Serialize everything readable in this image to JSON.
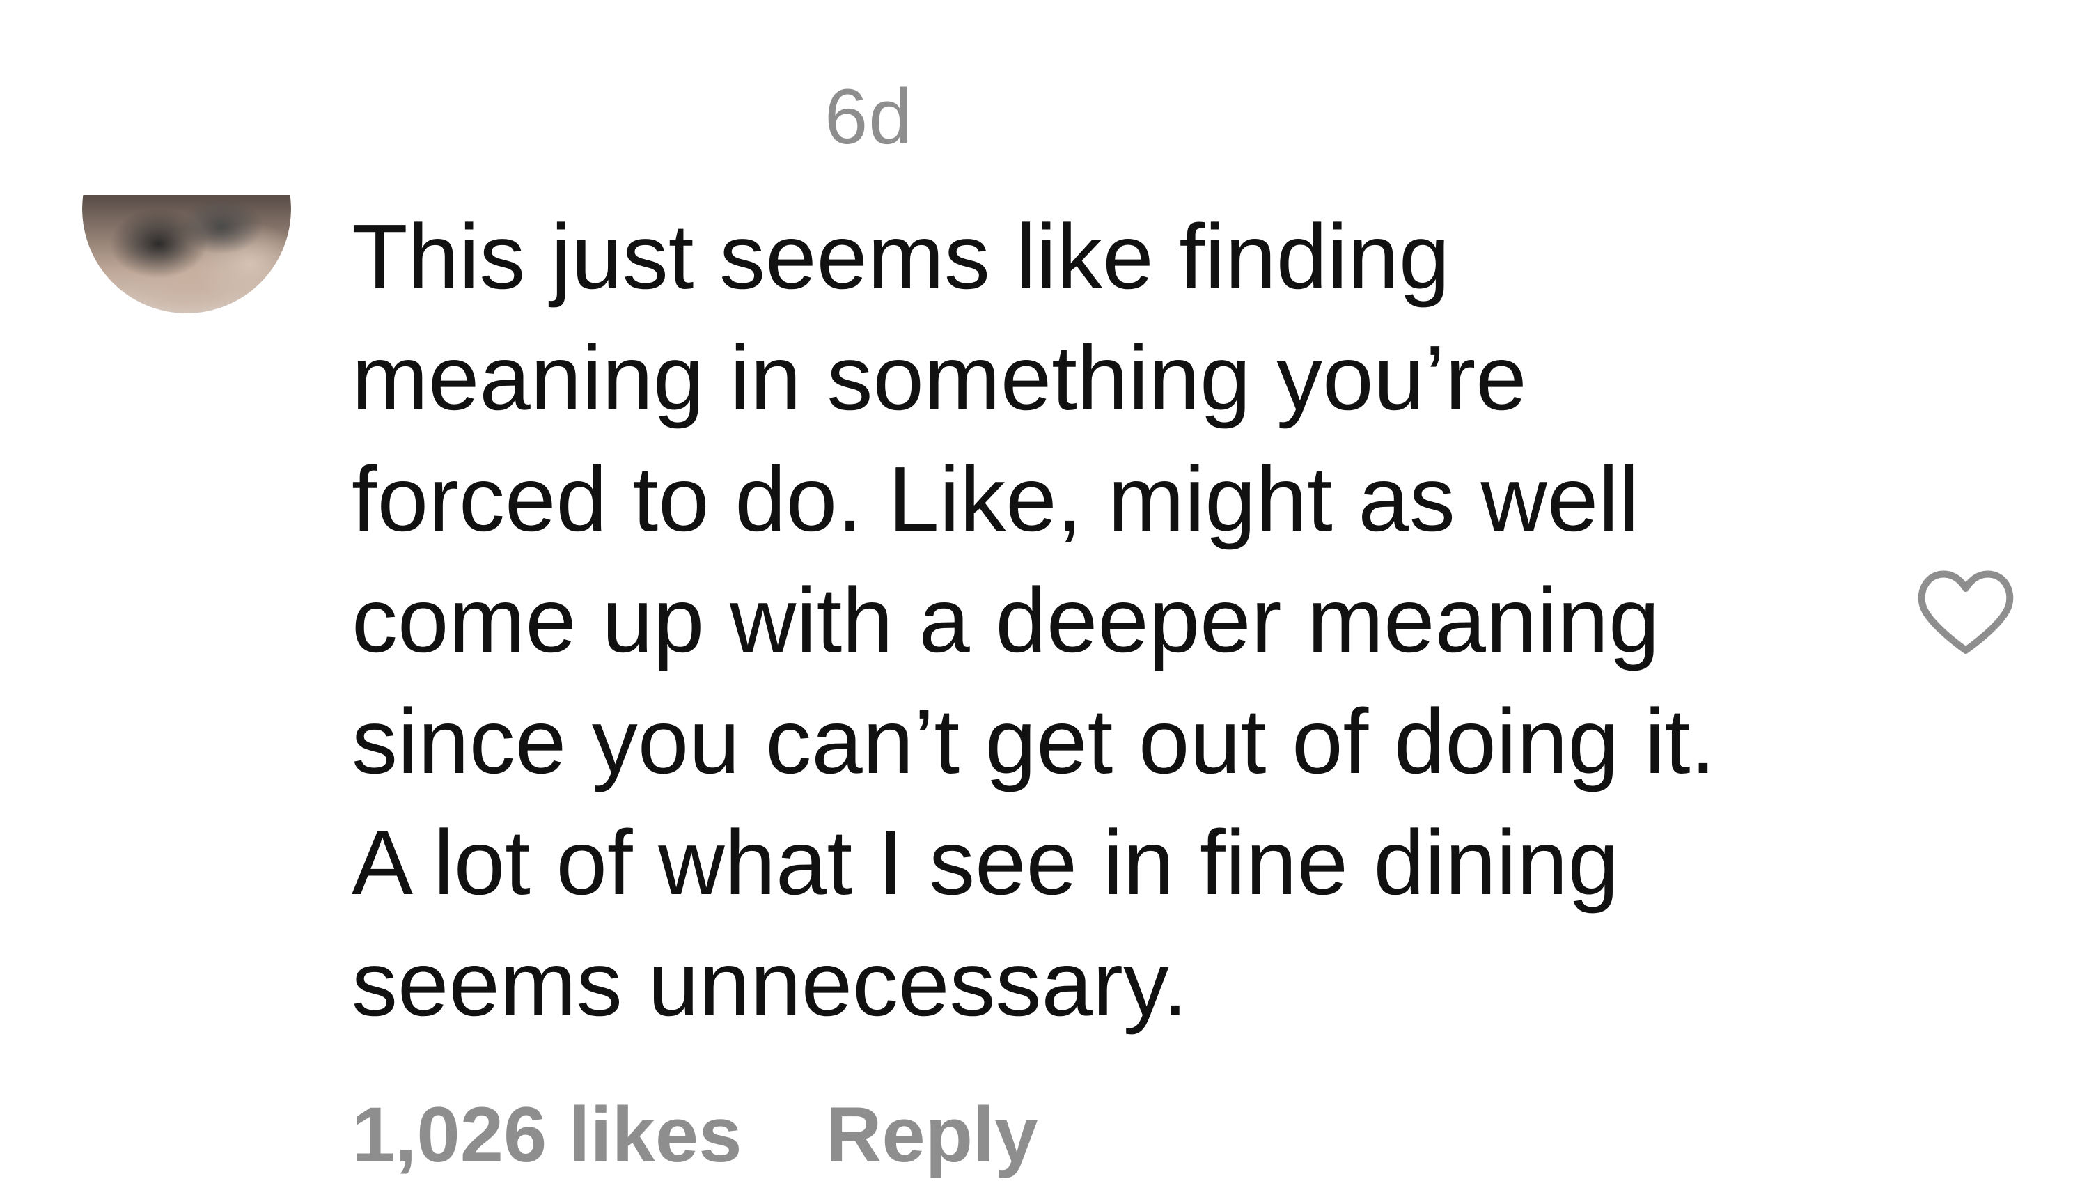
{
  "comment": {
    "timestamp": "6d",
    "text_lines": [
      "This just seems like finding",
      "meaning in something you’re",
      "forced to do. Like, might as well",
      "come up with a deeper meaning",
      "since you can’t get out of doing it.",
      "A lot of what I see in fine dining",
      "seems unnecessary."
    ],
    "likes_label": "1,026 likes",
    "reply_label": "Reply",
    "like_icon": "heart-outline-icon",
    "colors": {
      "text": "#111111",
      "secondary": "#8e8e8e",
      "background": "#ffffff"
    }
  }
}
